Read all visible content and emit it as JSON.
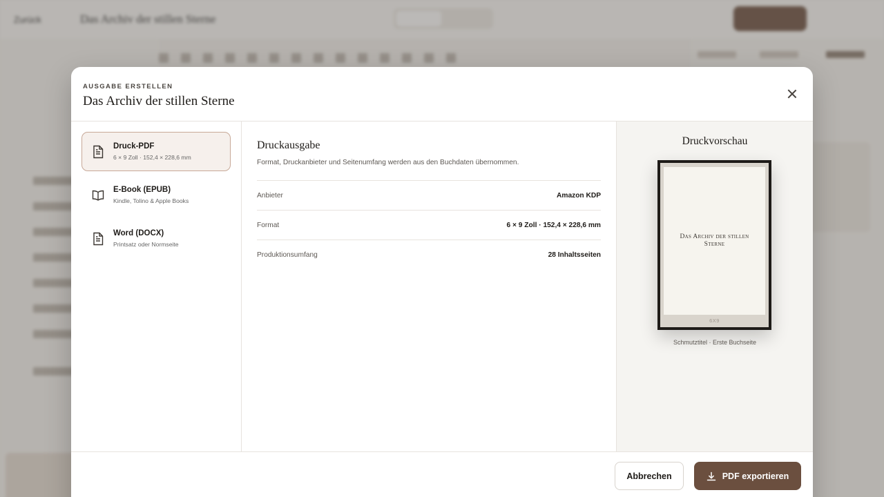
{
  "modal": {
    "eyebrow": "AUSGABE ERSTELLEN",
    "title": "Das Archiv der stillen Sterne",
    "close_icon": "close-icon"
  },
  "options": [
    {
      "label": "Druck-PDF",
      "sub": "6 × 9 Zoll · 152,4 × 228,6 mm",
      "icon": "document-icon",
      "selected": true
    },
    {
      "label": "E-Book (EPUB)",
      "sub": "Kindle, Tolino & Apple Books",
      "icon": "book-open-icon",
      "selected": false
    },
    {
      "label": "Word (DOCX)",
      "sub": "Printsatz oder Normseite",
      "icon": "document-icon",
      "selected": false
    }
  ],
  "detail": {
    "title": "Druckausgabe",
    "description": "Format, Druckanbieter und Seitenumfang werden aus den Buchdaten übernommen.",
    "rows": [
      {
        "key": "Anbieter",
        "value": "Amazon KDP"
      },
      {
        "key": "Format",
        "value": "6 × 9 Zoll · 152,4 × 228,6 mm"
      },
      {
        "key": "Produktionsumfang",
        "value": "28 Inhaltsseiten"
      }
    ]
  },
  "preview": {
    "title": "Druckvorschau",
    "book_title": "Das Archiv der stillen Sterne",
    "trim": "6X9",
    "caption": "Schmutztitel · Erste Buchseite"
  },
  "footer": {
    "cancel_label": "Abbrechen",
    "export_label": "PDF exportieren",
    "export_icon": "download-icon"
  },
  "background": {
    "back_label": "Zurück",
    "book_title": "Das Archiv der stillen Sterne"
  },
  "colors": {
    "accent": "#6b4f3f",
    "selected_bg": "#f6f0ec",
    "selected_border": "#c7a897"
  }
}
